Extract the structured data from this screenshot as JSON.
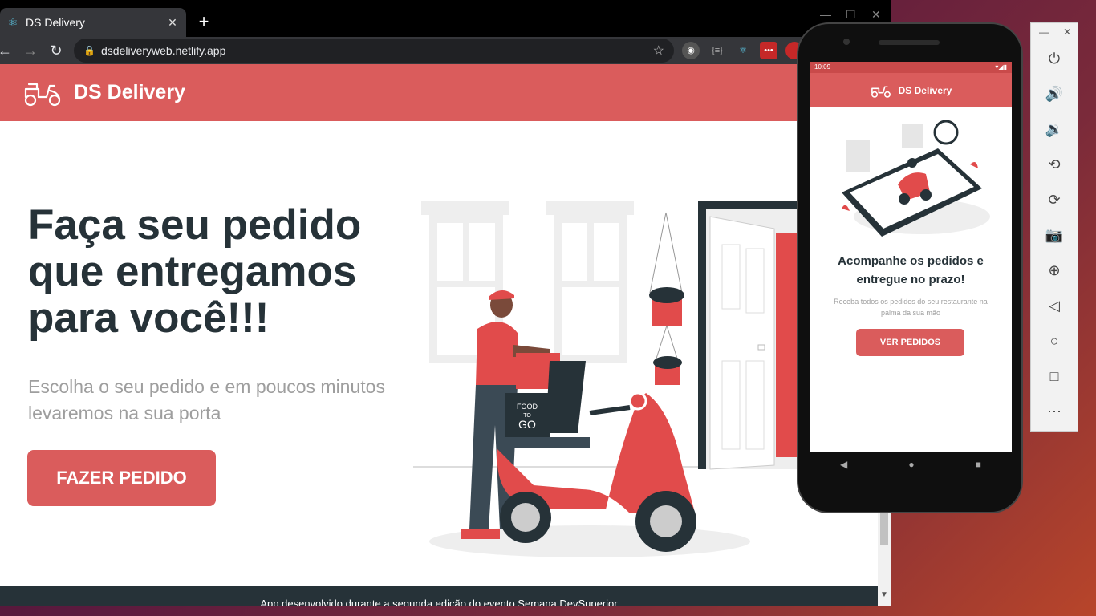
{
  "browser": {
    "tab_title": "DS Delivery",
    "tab_close": "✕",
    "new_tab": "+",
    "url": "dsdeliveryweb.netlify.app"
  },
  "site": {
    "brand": "DS Delivery",
    "hero_title": "Faça seu pedido que entregamos para você!!!",
    "hero_subtitle": "Escolha o seu pedido e em poucos minutos levaremos na sua porta",
    "cta_label": "FAZER PEDIDO",
    "footer_text": "App desenvolvido durante a segunda edição do evento Semana DevSuperior",
    "illustration_sign_line1": "FOOD",
    "illustration_sign_line2": "TO",
    "illustration_sign_line3": "GO"
  },
  "phone": {
    "status_time": "10:09",
    "app_title": "DS Delivery",
    "heading": "Acompanhe os pedidos e entregue no prazo!",
    "subtext": "Receba todos os pedidos do seu restaurante na palma da sua mão",
    "button_label": "VER PEDIDOS"
  },
  "colors": {
    "brand_red": "#da5c5c",
    "dark_text": "#263238",
    "muted_text": "#9e9e9e"
  }
}
